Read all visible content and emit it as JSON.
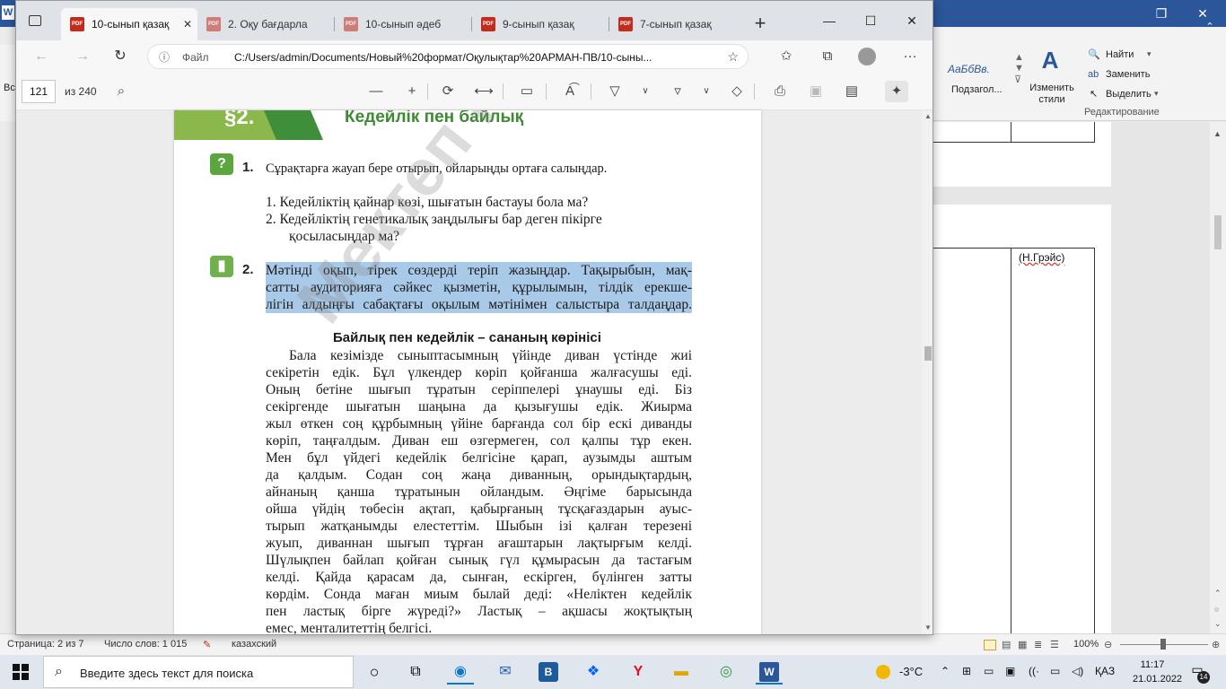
{
  "word": {
    "ribbon": {
      "style_sample": "АаБбВв.",
      "style_name": "Подзагол...",
      "change_styles": "Изменить стили",
      "find": "Найти",
      "replace": "Заменить",
      "select": "Выделить",
      "editing_group": "Редактирование",
      "left_cut": "Вс"
    },
    "doc": {
      "cell_text": "(Н.Грэйс)"
    },
    "status": {
      "page": "Страница: 2 из 7",
      "words": "Число слов: 1 015",
      "language": "казахский",
      "zoom": "100%"
    }
  },
  "edge": {
    "tabs": [
      {
        "label": "10-сынып қазақ",
        "active": true
      },
      {
        "label": "2. Оқу бағдарла",
        "active": false
      },
      {
        "label": "10-сынып әдеб",
        "active": false
      },
      {
        "label": "9-сынып қазақ",
        "active": false
      },
      {
        "label": "7-сынып қазақ",
        "active": false
      }
    ],
    "address": {
      "prefix": "Файл",
      "path": "C:/Users/admin/Documents/Новый%20формат/Оқулықтар%20АРМАН-ПВ/10-сыны..."
    },
    "pdf_toolbar": {
      "page_number": "121",
      "page_total": "из 240"
    },
    "pdf_page": {
      "section_number": "§2.",
      "chapter_title": "Кедейлік пен байлық",
      "q1_number": "1.",
      "q1_text": "Сұрақтарға жауап бере отырып, ойларыңды ортаға салыңдар.",
      "q1_items": [
        "1.  Кедейліктің қайнар көзі, шығатын бастауы бола ма?",
        "2.  Кедейліктің генетикалық заңдылығы бар деген пікірге",
        "қосыласыңдар ма?"
      ],
      "q2_number": "2.",
      "q2_lines": [
        "Мәтінді оқып, тірек сөздерді теріп жазыңдар. Тақырыбын, мақ-",
        "сатты аудиторияға сәйкес қызметін, құрылымын, тілдік ерекше-",
        "лігін алдыңғы сабақтағы оқылым мәтінімен салыстыра талдаңдар."
      ],
      "text_title": "Байлық пен кедейлік – сананың көрінісі",
      "body": [
        "Бала кезімізде сыныптасымның үйінде диван үстінде жиі",
        "секіретін едік. Бұл үлкендер көріп қойғанша жалғасушы еді.",
        "Оның бетіне шығып тұратын серіппелері ұнаушы еді. Біз",
        "секіргенде шығатын шаңына да қызығушы едік. Жиырма",
        "жыл өткен соң құрбымның үйіне барғанда сол бір ескі диванды",
        "көріп, таңғалдым. Диван еш өзгермеген, сол қалпы тұр екен.",
        "Мен бұл үйдегі кедейлік белгісіне қарап, аузымды аштым",
        "да қалдым. Содан соң жаңа диванның, орындықтардың,",
        "айнаның қанша тұратынын ойландым. Әңгіме барысында",
        "ойша үйдің төбесін ақтап, қабырғаның тұсқағаздарын ауыс-",
        "тырып жатқанымды елестеттім. Шыбын ізі қалған терезені",
        "жуып, диваннан шығып тұрған ағаштарын лақтырғым келді.",
        "Шүлықпен байлап қойған сынық гүл құмырасын да тастағым",
        "келді. Қайда қарасам да, сынған, ескірген, бүлінген затты",
        "көрдім. Сонда маған миым былай деді: «Неліктен кедейлік",
        "пен ластық бірге жүреді?» Ластық – ақшасы жоқтықтың",
        "емес, менталитеттің белгісі."
      ],
      "watermark": "Мектеп кітапханасы"
    }
  },
  "taskbar": {
    "search_placeholder": "Введите здесь текст для поиска",
    "weather": "-3°C",
    "lang": "ҚАЗ",
    "time": "11:17",
    "date": "21.01.2022",
    "notifications": "14"
  }
}
